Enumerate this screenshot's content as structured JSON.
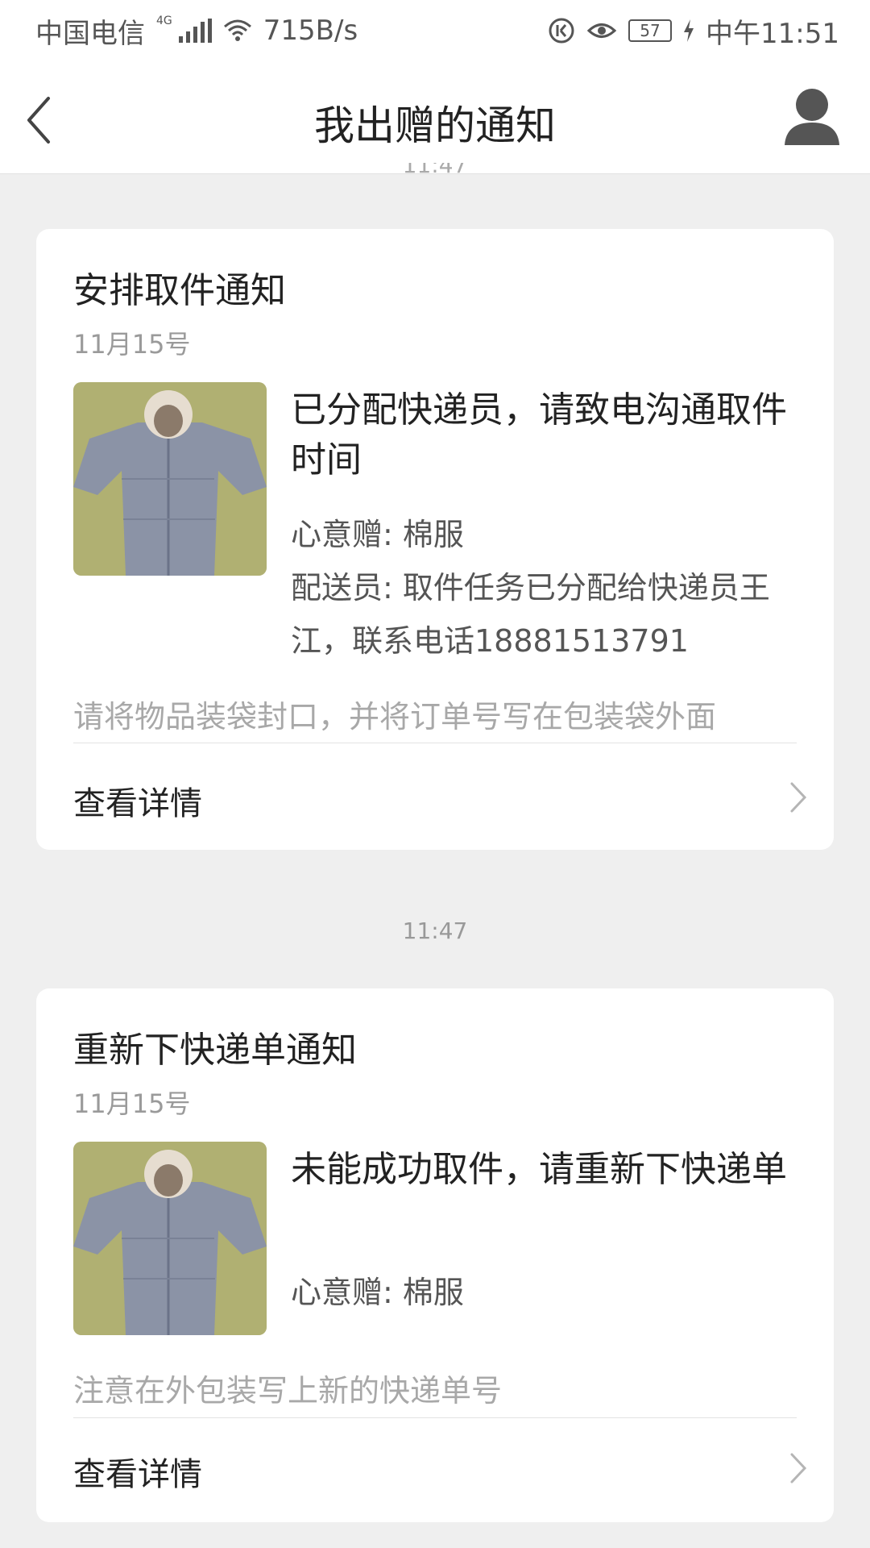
{
  "status_bar": {
    "carrier": "中国电信",
    "network_type": "4G",
    "speed": "715B/s",
    "battery": "57",
    "time": "中午11:51"
  },
  "nav": {
    "title": "我出赠的通知"
  },
  "peek_time": "11:47",
  "notifications": [
    {
      "title": "安排取件通知",
      "date": "11月15号",
      "message": "已分配快递员，请致电沟通取件时间",
      "gift_line": "心意赠: 棉服",
      "courier_line": "配送员: 取件任务已分配给快递员王江，联系电话18881513791",
      "note": "请将物品装袋封口，并将订单号写在包装袋外面",
      "link_label": "查看详情"
    },
    {
      "time": "11:47",
      "title": "重新下快递单通知",
      "date": "11月15号",
      "message": "未能成功取件，请重新下快递单",
      "gift_line": "心意赠: 棉服",
      "note": "注意在外包装写上新的快递单号",
      "link_label": "查看详情"
    }
  ],
  "colors": {
    "background": "#efefef",
    "card": "#ffffff",
    "muted_text": "#9a9a9a"
  }
}
